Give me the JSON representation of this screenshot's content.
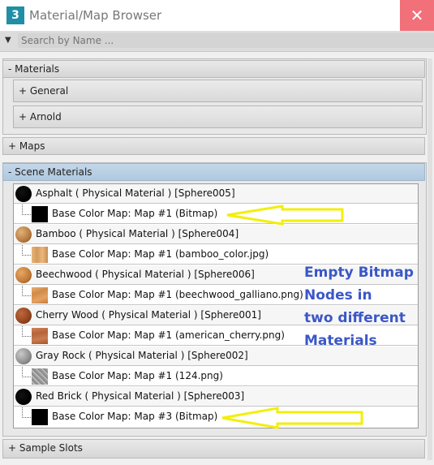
{
  "window": {
    "title": "Material/Map Browser",
    "app_icon_text": "3",
    "close_glyph": "✕"
  },
  "search": {
    "placeholder": "Search by Name ...",
    "caret_glyph": "▼"
  },
  "sections": {
    "materials": "- Materials",
    "general": "+ General",
    "arnold": "+ Arnold",
    "maps": "+ Maps",
    "scene_materials": "- Scene Materials",
    "sample_slots": "+ Sample Slots"
  },
  "scene_rows": [
    {
      "text": "Asphalt  ( Physical Material )  [Sphere005]",
      "type": "material",
      "swatch": "black"
    },
    {
      "text": "Base Color Map: Map #1 (Bitmap)",
      "type": "map",
      "swatch": "black"
    },
    {
      "text": "Bamboo  ( Physical Material )  [Sphere004]",
      "type": "material",
      "swatch": "bamboo"
    },
    {
      "text": "Base Color Map: Map #1 (bamboo_color.jpg)",
      "type": "map",
      "swatch": "bamboo"
    },
    {
      "text": "Beechwood  ( Physical Material )  [Sphere006]",
      "type": "material",
      "swatch": "beech"
    },
    {
      "text": "Base Color Map: Map #1 (beechwood_galliano.png)",
      "type": "map",
      "swatch": "beech"
    },
    {
      "text": "Cherry Wood  ( Physical Material )  [Sphere001]",
      "type": "material",
      "swatch": "cherry"
    },
    {
      "text": "Base Color Map: Map #1 (american_cherry.png)",
      "type": "map",
      "swatch": "cherry"
    },
    {
      "text": "Gray Rock  ( Physical Material )  [Sphere002]",
      "type": "material",
      "swatch": "rock"
    },
    {
      "text": "Base Color Map: Map #1 (124.png)",
      "type": "map",
      "swatch": "rock"
    },
    {
      "text": "Red Brick  ( Physical Material )  [Sphere003]",
      "type": "material",
      "swatch": "black"
    },
    {
      "text": "Base Color Map: Map #3 (Bitmap)",
      "type": "map",
      "swatch": "black"
    }
  ],
  "annotation": {
    "lines": [
      "Empty Bitmap",
      "Nodes in",
      "two different",
      "Materials"
    ],
    "text_color": "#3b57c7",
    "arrow_color": "#f2ef0a"
  },
  "colors": {
    "title_close_bg": "#f1707a",
    "active_section": "#b8cde3"
  }
}
